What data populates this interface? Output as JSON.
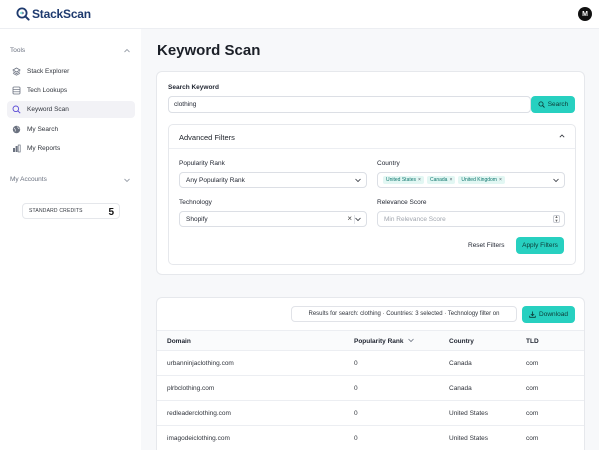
{
  "app": {
    "name": "StackScan",
    "avatar_initial": "M",
    "brand_color": "#1e3a6e",
    "accent_color": "#27d0c0"
  },
  "sidebar": {
    "tools_label": "Tools",
    "items": [
      {
        "label": "Stack Explorer",
        "icon": "layers-icon"
      },
      {
        "label": "Tech Lookups",
        "icon": "database-icon"
      },
      {
        "label": "Keyword Scan",
        "icon": "search-icon",
        "active": true
      },
      {
        "label": "My Search",
        "icon": "globe-icon"
      },
      {
        "label": "My Reports",
        "icon": "reports-icon"
      }
    ],
    "accounts_label": "My Accounts",
    "credits": {
      "label": "STANDARD CREDITS",
      "value": "5"
    }
  },
  "main": {
    "title": "Keyword Scan",
    "search": {
      "label": "Search Keyword",
      "value": "clothing",
      "button": "Search"
    },
    "advanced": {
      "title": "Advanced Filters",
      "popularity": {
        "label": "Popularity Rank",
        "value": "Any Popularity Rank"
      },
      "country": {
        "label": "Country",
        "tags": [
          "United States",
          "Canada",
          "United Kingdom"
        ]
      },
      "technology": {
        "label": "Technology",
        "value": "Shopify"
      },
      "relevance": {
        "label": "Relevance Score",
        "placeholder": "Min Relevance Score"
      },
      "reset": "Reset Filters",
      "apply": "Apply Filters"
    }
  },
  "results": {
    "summary": "Results for search: clothing · Countries: 3 selected · Technology filter on",
    "download": "Download",
    "columns": [
      "Domain",
      "Popularity Rank",
      "Country",
      "TLD"
    ],
    "rows": [
      [
        "urbanninjaclothing.com",
        "0",
        "Canada",
        "com"
      ],
      [
        "plrbclothing.com",
        "0",
        "Canada",
        "com"
      ],
      [
        "redleaderclothing.com",
        "0",
        "United States",
        "com"
      ],
      [
        "imagodeiclothing.com",
        "0",
        "United States",
        "com"
      ]
    ]
  }
}
